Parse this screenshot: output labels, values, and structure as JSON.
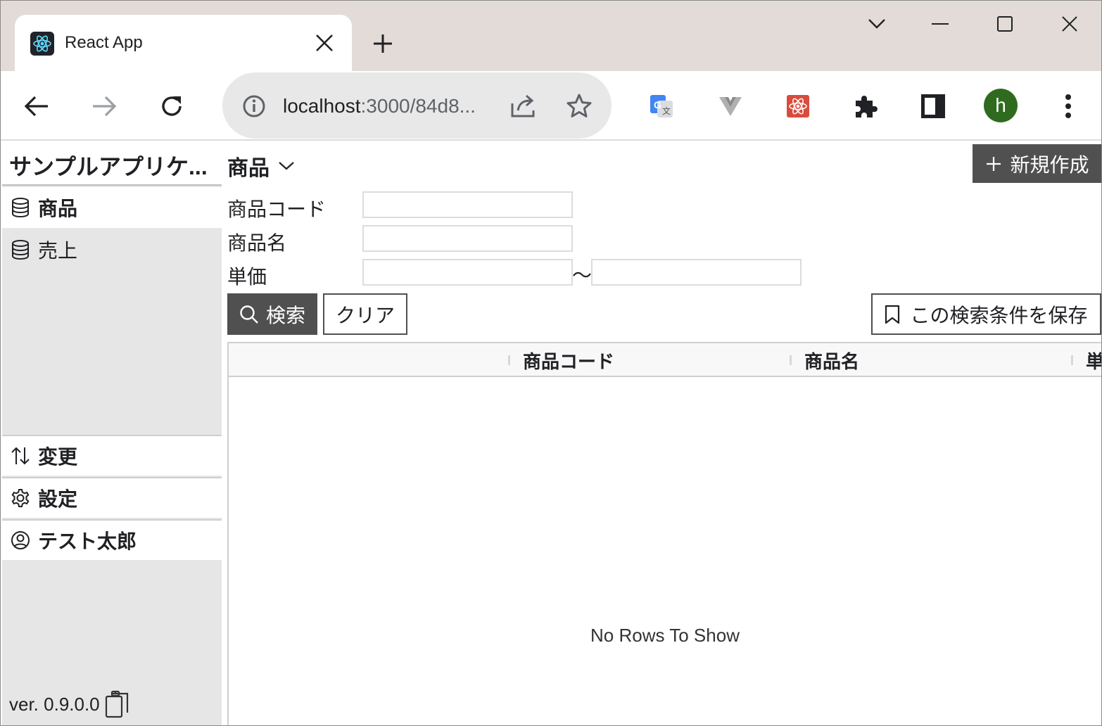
{
  "browser": {
    "tab_title": "React App",
    "url_host": "localhost",
    "url_rest": ":3000/84d8...",
    "avatar_letter": "h",
    "colors": {
      "titlebar": "#e2dbd7",
      "avatar": "#2e6b1f"
    }
  },
  "app": {
    "title": "サンプルアプリケ...",
    "nav": [
      {
        "label": "商品",
        "icon": "database-icon",
        "active": true
      },
      {
        "label": "売上",
        "icon": "database-icon",
        "active": false
      }
    ],
    "bottom_nav": [
      {
        "label": "変更",
        "icon": "swap-vertical-icon"
      },
      {
        "label": "設定",
        "icon": "gear-icon"
      },
      {
        "label": "テスト太郎",
        "icon": "user-circle-icon"
      }
    ],
    "version": "ver. 0.9.0.0"
  },
  "main": {
    "page_title": "商品",
    "new_button": "新規作成",
    "fields": {
      "code_label": "商品コード",
      "name_label": "商品名",
      "price_label": "単価",
      "range_sep": "〜",
      "code_value": "",
      "name_value": "",
      "price_from": "",
      "price_to": ""
    },
    "search_button": "検索",
    "clear_button": "クリア",
    "save_button": "この検索条件を保存",
    "grid": {
      "columns": [
        "商品コード",
        "商品名",
        "単"
      ],
      "empty_text": "No Rows To Show"
    }
  }
}
